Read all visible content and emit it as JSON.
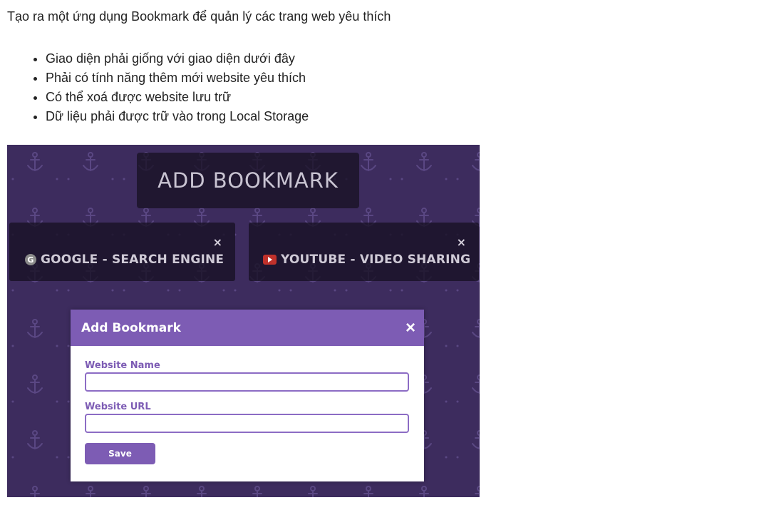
{
  "intro": "Tạo ra một ứng dụng Bookmark để quản lý các trang web yêu thích",
  "requirements": [
    "Giao diện phải giống với giao diện dưới đây",
    "Phải có tính năng thêm mới website yêu thích",
    "Có thể xoá được website lưu trữ",
    "Dữ liệu phải được trữ vào trong Local Storage"
  ],
  "mockup": {
    "add_bookmark_label": "ADD BOOKMARK",
    "cards": [
      {
        "label": "GOOGLE - SEARCH ENGINE",
        "icon": "google-icon",
        "close": "×"
      },
      {
        "label": "YOUTUBE - VIDEO SHARING",
        "icon": "youtube-icon",
        "close": "×"
      }
    ],
    "modal": {
      "title": "Add Bookmark",
      "close": "×",
      "name_label": "Website Name",
      "name_value": "",
      "url_label": "Website URL",
      "url_value": "",
      "save_label": "Save"
    }
  },
  "colors": {
    "background": "#3d2c5e",
    "accent": "#7d5cb4",
    "card": "#1c1528"
  }
}
